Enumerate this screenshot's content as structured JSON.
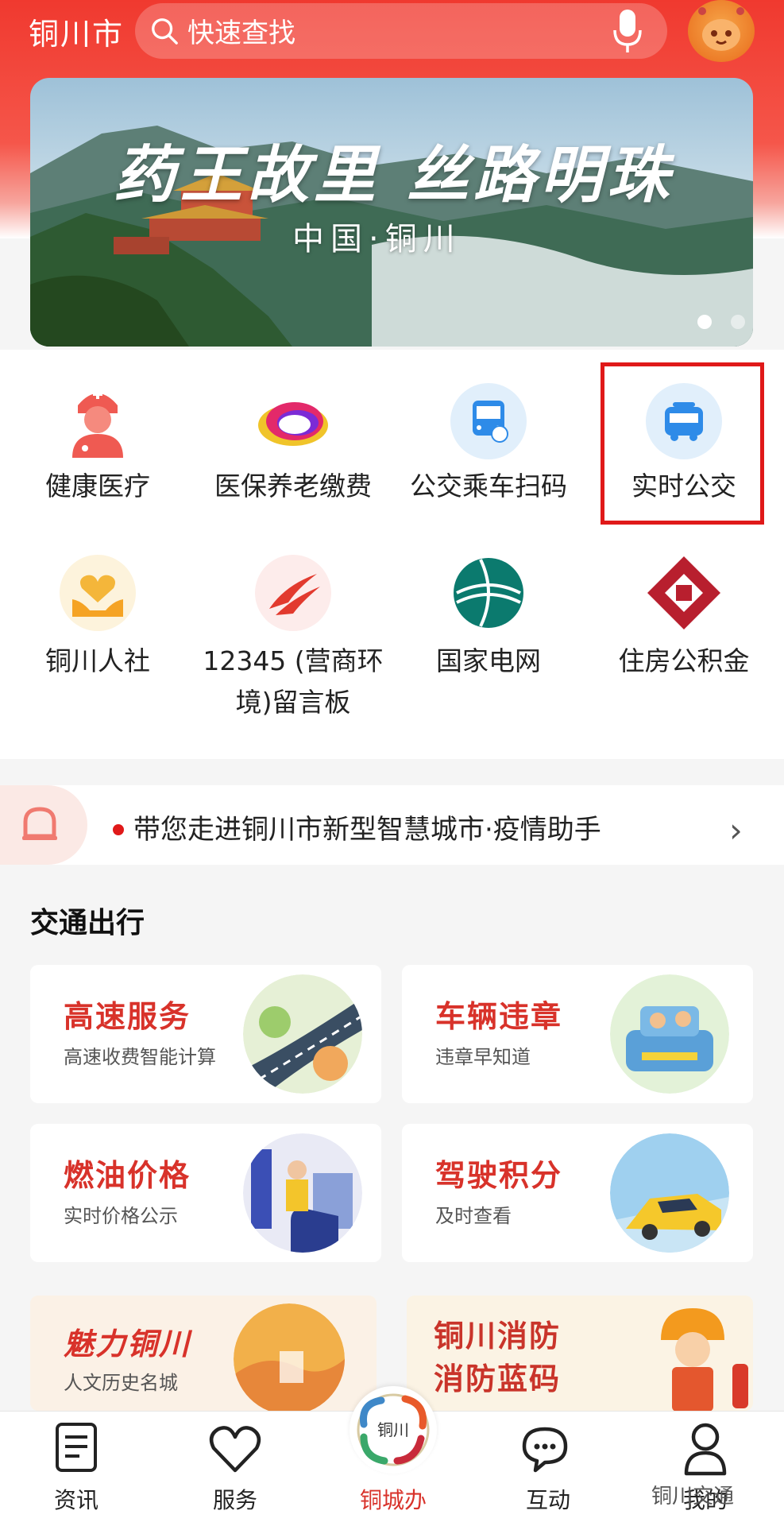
{
  "header": {
    "city": "铜川市",
    "search_placeholder": "快速查找"
  },
  "banner": {
    "title": "药王故里 丝路明珠",
    "subtitle": "中国·铜川"
  },
  "services": [
    {
      "label": "健康医疗",
      "icon": "doctor-icon"
    },
    {
      "label": "医保养老缴费",
      "icon": "insurance-cloud-icon"
    },
    {
      "label": "公交乘车扫码",
      "icon": "bus-qr-icon"
    },
    {
      "label": "实时公交",
      "icon": "bus-icon"
    },
    {
      "label": "铜川人社",
      "icon": "heart-hands-icon"
    },
    {
      "label_line1": "12345 (营商环",
      "label_line2": "境)留言板",
      "icon": "hotline-icon"
    },
    {
      "label": "国家电网",
      "icon": "state-grid-icon"
    },
    {
      "label": "住房公积金",
      "icon": "housing-fund-icon"
    }
  ],
  "notice": {
    "text": "带您走进铜川市新型智慧城市·疫情助手"
  },
  "section": {
    "title": "交通出行",
    "cards": [
      {
        "title": "高速服务",
        "subtitle": "高速收费智能计算",
        "art": "highway-art"
      },
      {
        "title": "车辆违章",
        "subtitle": "违章早知道",
        "art": "car-family-art"
      },
      {
        "title": "燃油价格",
        "subtitle": "实时价格公示",
        "art": "fuel-station-art"
      },
      {
        "title": "驾驶积分",
        "subtitle": "及时查看",
        "art": "yellow-car-art"
      },
      {
        "title": "魅力铜川",
        "subtitle": "人文历史名城",
        "art": "culture-art"
      },
      {
        "title_line1": "铜川消防",
        "title_line2": "消防蓝码",
        "art": "firefighter-art"
      }
    ]
  },
  "nav": {
    "items": [
      {
        "label": "资讯",
        "icon": "news-icon"
      },
      {
        "label": "服务",
        "icon": "heart-icon"
      },
      {
        "label": "铜城办",
        "icon": "tongchuan-logo-icon",
        "active": true
      },
      {
        "label": "互动",
        "icon": "chat-icon"
      },
      {
        "label": "我的",
        "icon": "user-icon"
      }
    ],
    "center_logo_text": "铜川",
    "watermark": "铜川交通"
  },
  "colors": {
    "brand_red": "#e23a2e",
    "highlight_border": "#e01919",
    "card_title": "#d8322a"
  }
}
